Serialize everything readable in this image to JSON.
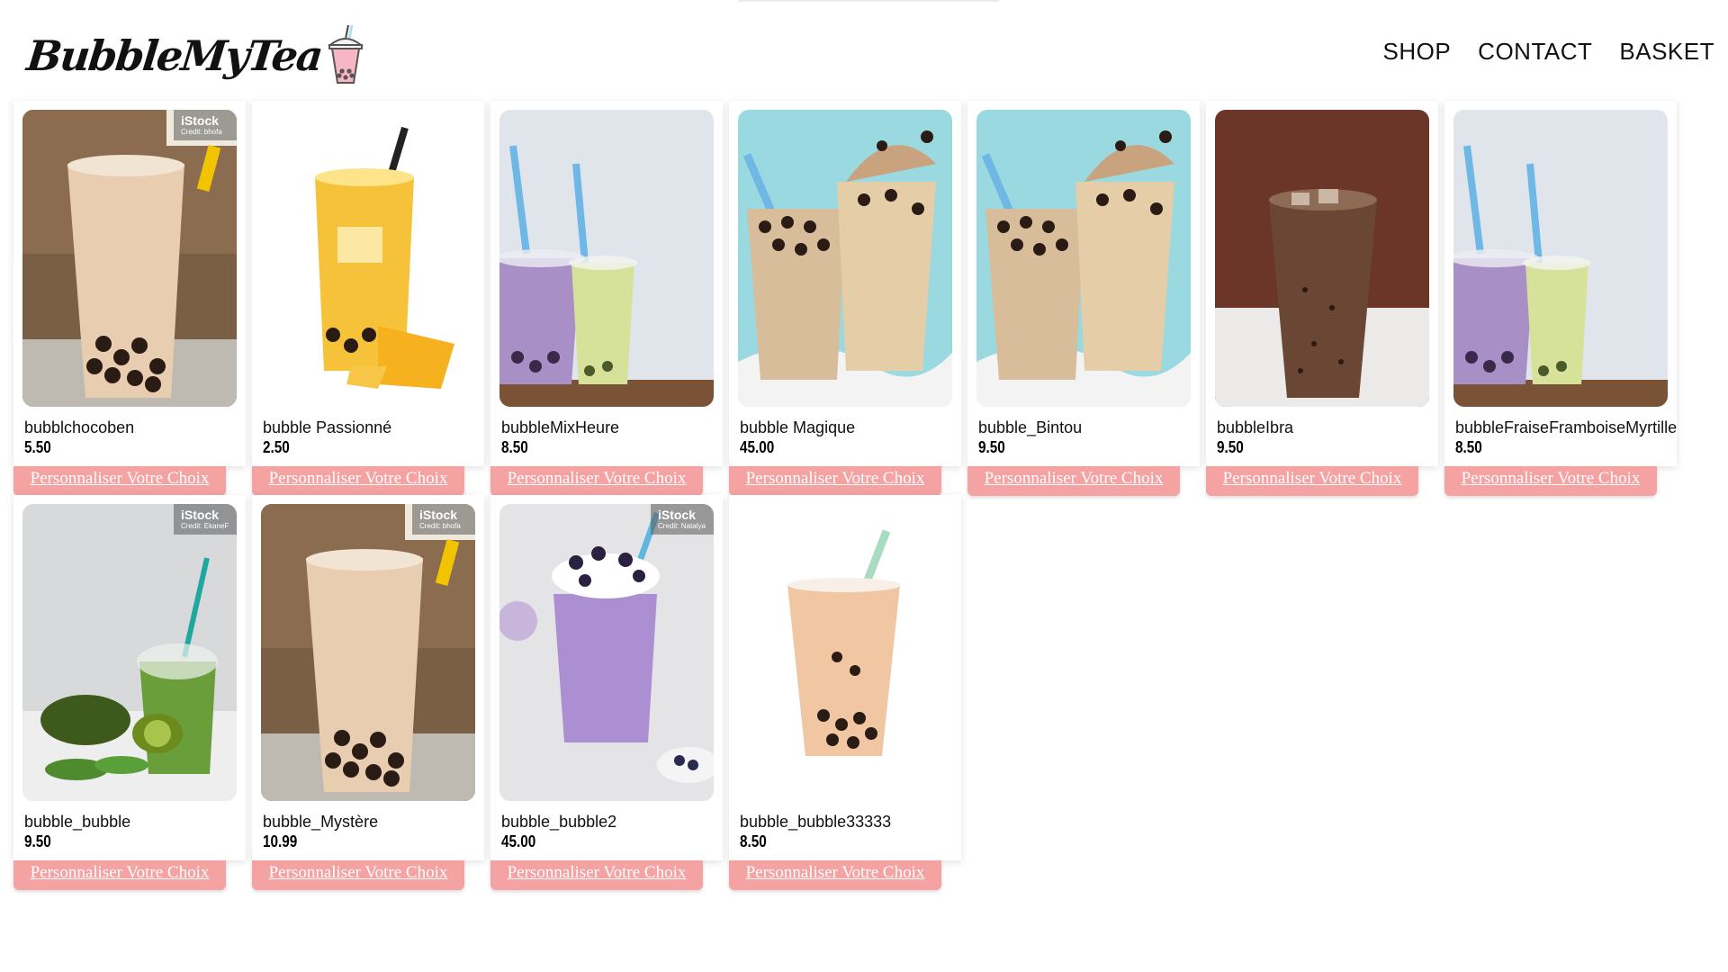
{
  "header": {
    "logo_text": "BubbleMyTea",
    "nav": [
      {
        "label": "SHOP"
      },
      {
        "label": "CONTACT"
      },
      {
        "label": "BASKET"
      }
    ]
  },
  "colors": {
    "cta_background": "#f5a2a2",
    "cta_text": "#ffffff",
    "logo_cup_pink": "#f7b6c3"
  },
  "products": [
    {
      "name": "bubblchocoben",
      "price": "5.50",
      "cta": "Personnaliser Votre Choix",
      "image": "milk-tea-ice-boba-photo",
      "watermark": "iStock",
      "watermark_credit": "Credit: bhofa"
    },
    {
      "name": "bubble Passionné",
      "price": "2.50",
      "cta": "Personnaliser Votre Choix",
      "image": "mango-boba-tea-photo"
    },
    {
      "name": "bubbleMixHeure",
      "price": "8.50",
      "cta": "Personnaliser Votre Choix",
      "image": "purple-and-green-boba-photo"
    },
    {
      "name": "bubble Magique",
      "price": "45.00",
      "cta": "Personnaliser Votre Choix",
      "image": "milk-splash-boba-photo"
    },
    {
      "name": "bubble_Bintou",
      "price": "9.50",
      "cta": "Personnaliser Votre Choix",
      "image": "milk-splash-boba-photo"
    },
    {
      "name": "bubbleIbra",
      "price": "9.50",
      "cta": "Personnaliser Votre Choix",
      "image": "iced-coffee-photo"
    },
    {
      "name": "bubbleFraiseFramboiseMyrtille",
      "price": "8.50",
      "cta": "Personnaliser Votre Choix",
      "image": "purple-and-green-boba-photo"
    },
    {
      "name": "bubble_bubble",
      "price": "9.50",
      "cta": "Personnaliser Votre Choix",
      "image": "avocado-kiwi-smoothie-photo",
      "watermark": "iStock",
      "watermark_credit": "Credit: EkaneF"
    },
    {
      "name": "bubble_Mystère",
      "price": "10.99",
      "cta": "Personnaliser Votre Choix",
      "image": "milk-tea-ice-boba-photo",
      "watermark": "iStock",
      "watermark_credit": "Credit: bhofa"
    },
    {
      "name": "bubble_bubble2",
      "price": "45.00",
      "cta": "Personnaliser Votre Choix",
      "image": "blueberry-milkshake-photo",
      "watermark": "iStock",
      "watermark_credit": "Credit: Natalya"
    },
    {
      "name": "bubble_bubble33333",
      "price": "8.50",
      "cta": "Personnaliser Votre Choix",
      "image": "classic-boba-cup-photo"
    }
  ]
}
